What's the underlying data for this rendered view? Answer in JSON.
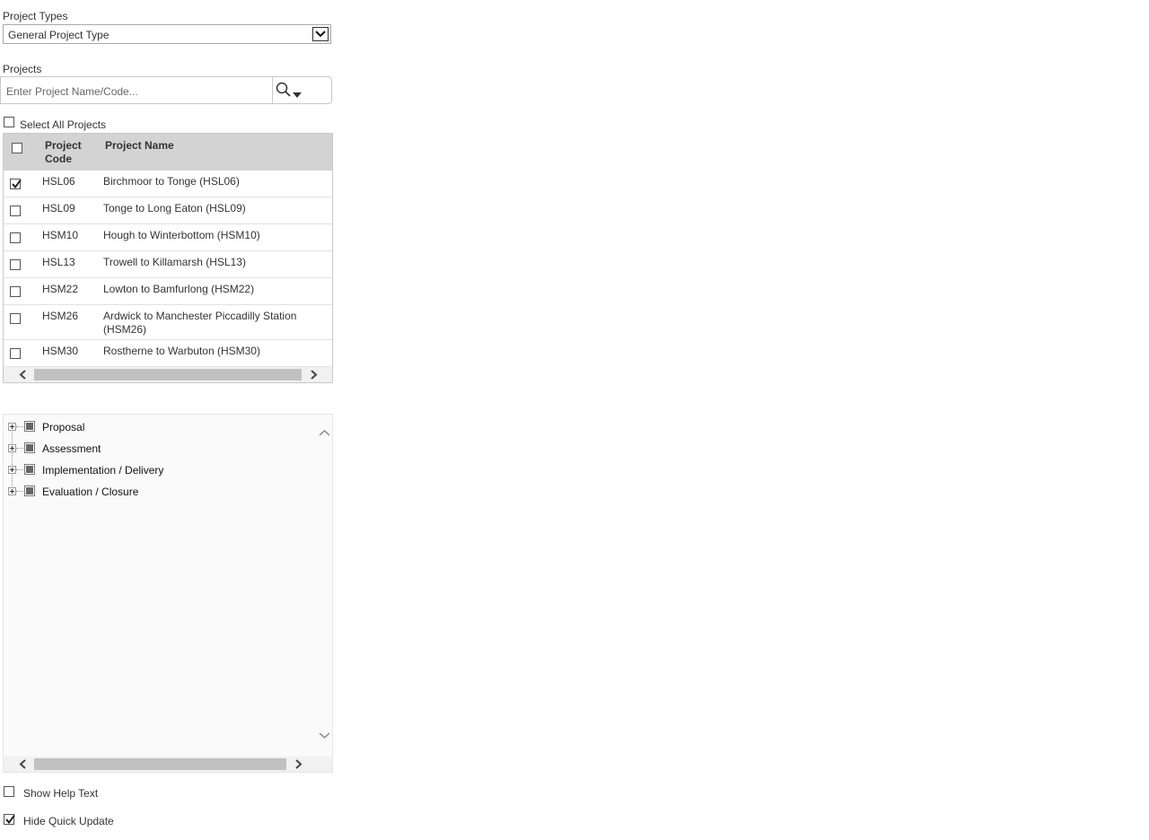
{
  "project_types": {
    "label": "Project Types",
    "selected": "General Project Type"
  },
  "projects": {
    "label": "Projects",
    "search_placeholder": "Enter Project Name/Code...",
    "select_all_label": "Select All Projects",
    "select_all_checked": false
  },
  "grid": {
    "columns": [
      "Project Code",
      "Project Name"
    ],
    "column_code_line1": "Project",
    "column_code_line2": "Code",
    "rows": [
      {
        "code": "HSL06",
        "name": "Birchmoor to Tonge (HSL06)",
        "checked": true
      },
      {
        "code": "HSL09",
        "name": "Tonge to Long Eaton (HSL09)",
        "checked": false
      },
      {
        "code": "HSM10",
        "name": "Hough to Winterbottom (HSM10)",
        "checked": false
      },
      {
        "code": "HSL13",
        "name": "Trowell to Killamarsh (HSL13)",
        "checked": false
      },
      {
        "code": "HSM22",
        "name": "Lowton to Bamfurlong (HSM22)",
        "checked": false
      },
      {
        "code": "HSM26",
        "name": "Ardwick to Manchester Piccadilly Station (HSM26)",
        "checked": false
      },
      {
        "code": "HSM30",
        "name": "Rostherne to Warbuton (HSM30)",
        "checked": false
      }
    ]
  },
  "tree": {
    "items": [
      {
        "label": "Proposal"
      },
      {
        "label": "Assessment"
      },
      {
        "label": "Implementation / Delivery"
      },
      {
        "label": "Evaluation / Closure"
      }
    ]
  },
  "options": {
    "show_help_text": "Show Help Text",
    "show_help_checked": false,
    "hide_quick_update": "Hide Quick Update",
    "hide_quick_update_checked": true
  },
  "icons": {
    "search": "search-icon",
    "caret": "caret-down-icon",
    "chevron_left": "chevron-left-icon",
    "chevron_right": "chevron-right-icon",
    "chevron_up": "chevron-up-icon",
    "chevron_down": "chevron-down-icon"
  }
}
